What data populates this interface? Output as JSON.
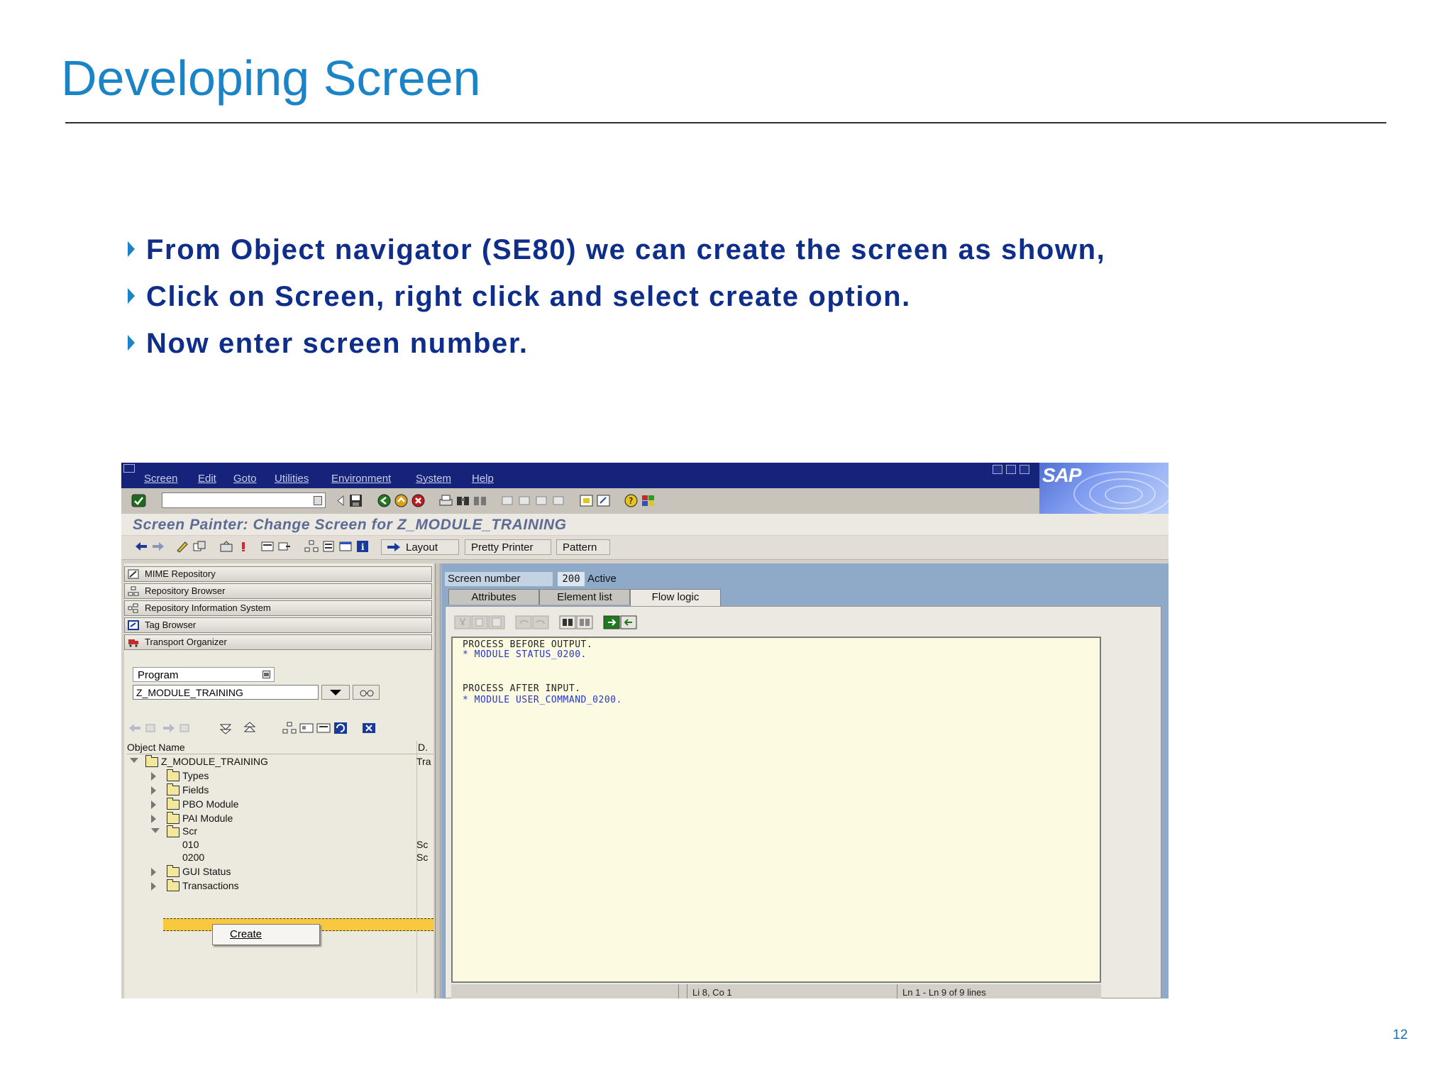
{
  "slide": {
    "title": "Developing Screen",
    "bullets": [
      "From Object navigator (SE80) we can create the screen as shown,",
      "Click on Screen, right click and select create option.",
      "Now enter screen number."
    ],
    "page_number": "12"
  },
  "sap": {
    "menu": [
      "Screen",
      "Edit",
      "Goto",
      "Utilities",
      "Environment",
      "System",
      "Help"
    ],
    "logo_text": "SAP",
    "window_title": "Screen Painter: Change Screen for Z_MODULE_TRAINING",
    "app_toolbar": {
      "layout_label": "Layout",
      "pretty_printer_label": "Pretty Printer",
      "pattern_label": "Pattern"
    },
    "navigator": {
      "buttons": [
        "MIME Repository",
        "Repository Browser",
        "Repository Information System",
        "Tag Browser",
        "Transport Organizer"
      ],
      "object_type": "Program",
      "object_name": "Z_MODULE_TRAINING",
      "columns": [
        "Object Name",
        "D."
      ],
      "tree": {
        "root": "Z_MODULE_TRAINING",
        "root_desc": "Tra",
        "children": [
          "Types",
          "Fields",
          "PBO Module",
          "PAI Module",
          "Scr"
        ],
        "screens": [
          {
            "number": "010",
            "desc": "Sc"
          },
          {
            "number": "0200",
            "desc": "Sc"
          }
        ],
        "after": [
          "GUI Status",
          "Transactions"
        ]
      },
      "context_menu": "Create"
    },
    "editor": {
      "screen_number_label": "Screen number",
      "screen_number": "200",
      "status": "Active",
      "tabs": [
        "Attributes",
        "Element list",
        "Flow logic"
      ],
      "code": [
        "PROCESS BEFORE OUTPUT.",
        "* MODULE STATUS_0200.",
        "",
        "",
        "PROCESS AFTER INPUT.",
        "* MODULE USER_COMMAND_0200."
      ],
      "status_bar": {
        "position": "Li 8, Co 1",
        "lines": "Ln 1 - Ln 9 of 9 lines"
      }
    }
  }
}
